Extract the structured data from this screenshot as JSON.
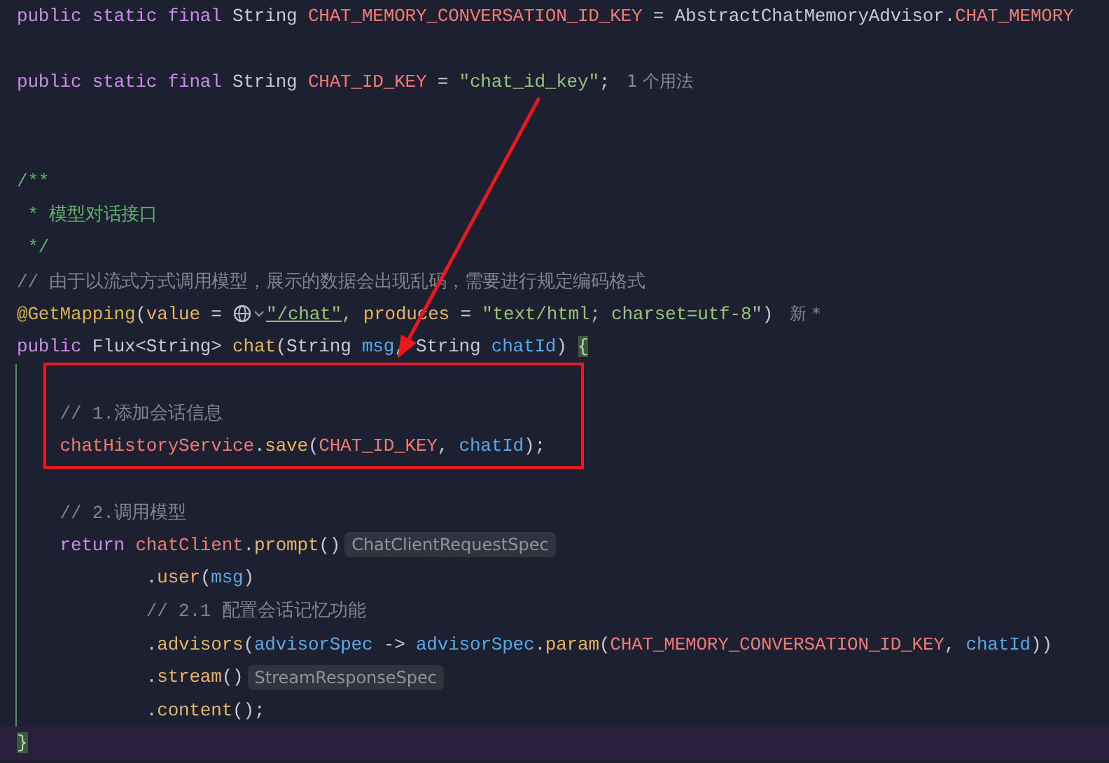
{
  "editor": {
    "lines": [
      {
        "changed": false,
        "current": false,
        "tokens": [
          {
            "kind": "kw",
            "text": "public static final "
          },
          {
            "kind": "plain",
            "text": "String "
          },
          {
            "kind": "const",
            "text": "CHAT_MEMORY_CONVERSATION_ID_KEY"
          },
          {
            "kind": "plain",
            "text": " = AbstractChatMemoryAdvisor."
          },
          {
            "kind": "const",
            "text": "CHAT_MEMORY"
          }
        ]
      },
      {
        "changed": false,
        "current": false
      },
      {
        "changed": false,
        "current": false,
        "tokens": [
          {
            "kind": "kw",
            "text": "public static final "
          },
          {
            "kind": "plain",
            "text": "String "
          },
          {
            "kind": "const",
            "text": "CHAT_ID_KEY"
          },
          {
            "kind": "plain",
            "text": " = "
          },
          {
            "kind": "str",
            "text": "\"chat_id_key\""
          },
          {
            "kind": "plain",
            "text": ";"
          },
          {
            "kind": "hint",
            "text": "1 个用法"
          }
        ]
      },
      {
        "changed": false,
        "current": false
      },
      {
        "changed": false,
        "current": false
      },
      {
        "changed": false,
        "current": false,
        "tokens": [
          {
            "kind": "doc",
            "text": "/**"
          }
        ]
      },
      {
        "changed": false,
        "current": false,
        "tokens": [
          {
            "kind": "doc",
            "text": " * 模型对话接口"
          }
        ]
      },
      {
        "changed": false,
        "current": false,
        "tokens": [
          {
            "kind": "doc",
            "text": " */"
          }
        ]
      },
      {
        "changed": false,
        "current": false,
        "tokens": [
          {
            "kind": "comment",
            "text": "// 由于以流式方式调用模型，展示的数据会出现乱码，需要进行规定编码格式"
          }
        ]
      },
      {
        "changed": false,
        "current": false,
        "tokens": [
          {
            "kind": "annot",
            "text": "@GetMapping"
          },
          {
            "kind": "plain",
            "text": "("
          },
          {
            "kind": "method",
            "text": "value"
          },
          {
            "kind": "plain",
            "text": " = "
          },
          {
            "kind": "globe"
          },
          {
            "kind": "link",
            "text": "\"/chat\""
          },
          {
            "kind": "str",
            "text": ", "
          },
          {
            "kind": "method",
            "text": "produces"
          },
          {
            "kind": "plain",
            "text": " = "
          },
          {
            "kind": "str",
            "text": "\"text/html; charset=utf-8\""
          },
          {
            "kind": "plain",
            "text": ")"
          },
          {
            "kind": "hint",
            "text": "新 *"
          }
        ]
      },
      {
        "changed": false,
        "current": false,
        "tokens": [
          {
            "kind": "kw",
            "text": "public "
          },
          {
            "kind": "plain",
            "text": "Flux<String> "
          },
          {
            "kind": "method",
            "text": "chat"
          },
          {
            "kind": "plain",
            "text": "(String "
          },
          {
            "kind": "param",
            "text": "msg"
          },
          {
            "kind": "plain",
            "text": ", String "
          },
          {
            "kind": "param",
            "text": "chatId"
          },
          {
            "kind": "plain",
            "text": ") "
          },
          {
            "kind": "brace",
            "text": "{"
          }
        ]
      },
      {
        "changed": true,
        "current": false
      },
      {
        "changed": true,
        "current": false,
        "tokens": [
          {
            "kind": "comment",
            "text": "    // 1.添加会话信息"
          }
        ]
      },
      {
        "changed": true,
        "current": false,
        "tokens": [
          {
            "kind": "const",
            "text": "    chatHistoryService"
          },
          {
            "kind": "plain",
            "text": "."
          },
          {
            "kind": "method",
            "text": "save"
          },
          {
            "kind": "plain",
            "text": "("
          },
          {
            "kind": "const",
            "text": "CHAT_ID_KEY"
          },
          {
            "kind": "plain",
            "text": ", "
          },
          {
            "kind": "param",
            "text": "chatId"
          },
          {
            "kind": "plain",
            "text": ");"
          }
        ]
      },
      {
        "changed": true,
        "current": false
      },
      {
        "changed": true,
        "current": false,
        "tokens": [
          {
            "kind": "comment",
            "text": "    // 2.调用模型"
          }
        ]
      },
      {
        "changed": true,
        "current": false,
        "tokens": [
          {
            "kind": "kw",
            "text": "    return "
          },
          {
            "kind": "const",
            "text": "chatClient"
          },
          {
            "kind": "plain",
            "text": "."
          },
          {
            "kind": "method",
            "text": "prompt"
          },
          {
            "kind": "plain",
            "text": "()"
          },
          {
            "kind": "hintbox",
            "text": "ChatClientRequestSpec"
          }
        ]
      },
      {
        "changed": true,
        "current": false,
        "tokens": [
          {
            "kind": "plain",
            "text": "            ."
          },
          {
            "kind": "method",
            "text": "user"
          },
          {
            "kind": "plain",
            "text": "("
          },
          {
            "kind": "param",
            "text": "msg"
          },
          {
            "kind": "plain",
            "text": ")"
          }
        ]
      },
      {
        "changed": true,
        "current": false,
        "tokens": [
          {
            "kind": "comment",
            "text": "            // 2.1 配置会话记忆功能"
          }
        ]
      },
      {
        "changed": true,
        "current": false,
        "tokens": [
          {
            "kind": "plain",
            "text": "            ."
          },
          {
            "kind": "method",
            "text": "advisors"
          },
          {
            "kind": "plain",
            "text": "("
          },
          {
            "kind": "param",
            "text": "advisorSpec"
          },
          {
            "kind": "plain",
            "text": " -> "
          },
          {
            "kind": "param",
            "text": "advisorSpec"
          },
          {
            "kind": "plain",
            "text": "."
          },
          {
            "kind": "method",
            "text": "param"
          },
          {
            "kind": "plain",
            "text": "("
          },
          {
            "kind": "const",
            "text": "CHAT_MEMORY_CONVERSATION_ID_KEY"
          },
          {
            "kind": "plain",
            "text": ", "
          },
          {
            "kind": "param",
            "text": "chatId"
          },
          {
            "kind": "plain",
            "text": "))"
          }
        ]
      },
      {
        "changed": true,
        "current": false,
        "tokens": [
          {
            "kind": "plain",
            "text": "            ."
          },
          {
            "kind": "method",
            "text": "stream"
          },
          {
            "kind": "plain",
            "text": "()"
          },
          {
            "kind": "hintbox",
            "text": "StreamResponseSpec"
          }
        ]
      },
      {
        "changed": true,
        "current": false,
        "tokens": [
          {
            "kind": "plain",
            "text": "            ."
          },
          {
            "kind": "method",
            "text": "content"
          },
          {
            "kind": "plain",
            "text": "();"
          }
        ]
      },
      {
        "changed": false,
        "current": true,
        "tokens": [
          {
            "kind": "brace",
            "text": "}"
          }
        ]
      }
    ]
  }
}
